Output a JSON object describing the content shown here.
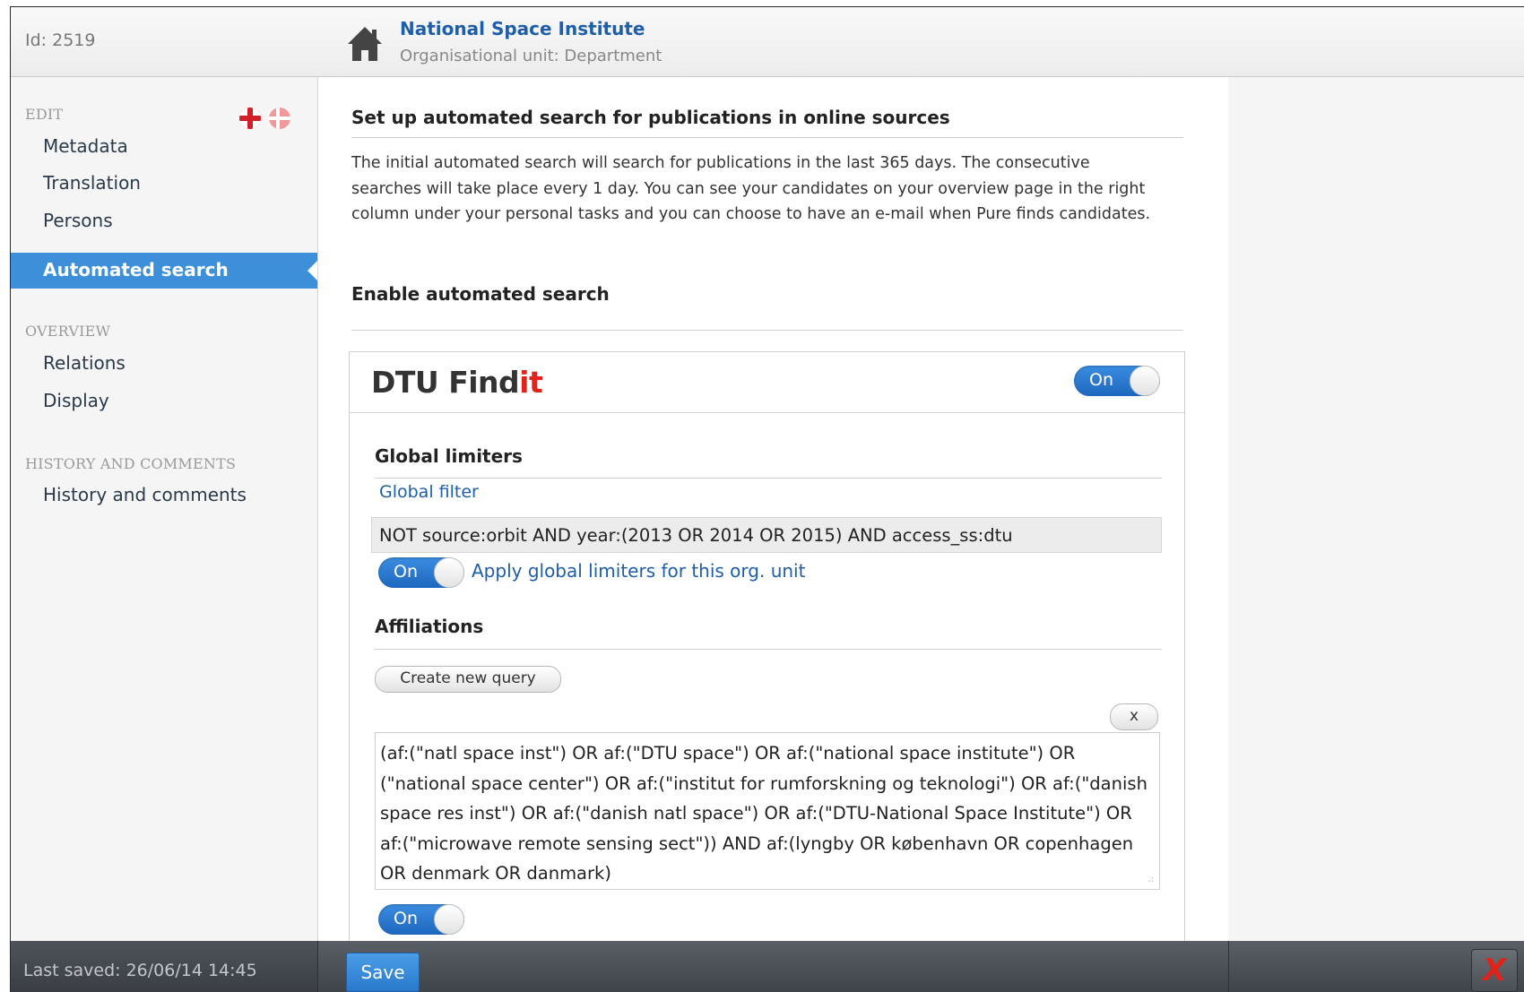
{
  "header": {
    "id_text": "Id: 2519",
    "title": "National Space Institute",
    "subtitle": "Organisational unit: Department",
    "home_icon": "home-icon"
  },
  "sidebar": {
    "edit_heading": "EDIT",
    "flags": [
      "flag-uk-icon",
      "flag-dk-icon"
    ],
    "edit_items": [
      "Metadata",
      "Translation",
      "Persons",
      "Automated search"
    ],
    "active_item": "Automated search",
    "overview_heading": "OVERVIEW",
    "overview_items": [
      "Relations",
      "Display"
    ],
    "history_heading": "HISTORY AND COMMENTS",
    "history_items": [
      "History and comments"
    ]
  },
  "main": {
    "setup_heading": "Set up automated search for publications in online sources",
    "intro_text": "The initial automated search will search for publications in the last 365 days. The consecutive searches will take place every 1 day. You can see your candidates on your overview page in the right column under your personal tasks and you can choose to have an e-mail when Pure finds candidates.",
    "enable_heading": "Enable automated search",
    "findit": {
      "logo_text_main": "DTU Find",
      "logo_text_accent": "it",
      "toggle_label": "On",
      "global_limiters_heading": "Global limiters",
      "global_filter_label": "Global filter",
      "global_filter_value": "NOT source:orbit AND year:(2013 OR 2014 OR 2015) AND access_ss:dtu",
      "apply_toggle_label": "On",
      "apply_label": "Apply global limiters for this org. unit",
      "affiliations_heading": "Affiliations",
      "create_query_label": "Create new query",
      "remove_query_label": "x",
      "query_value": "(af:(\"natl space inst\") OR af:(\"DTU space\") OR af:(\"national space institute\") OR (\"national space center\") OR af:(\"institut for rumforskning og teknologi\") OR af:(\"danish space res inst\") OR af:(\"danish natl space\") OR af:(\"DTU-National Space Institute\") OR af:(\"microwave remote sensing sect\")) AND af:(lyngby OR københavn OR copenhagen OR denmark OR danmark)",
      "query_toggle_label": "On"
    }
  },
  "footer": {
    "last_saved": "Last saved: 26/06/14 14:45",
    "save_label": "Save",
    "close_label": "X"
  },
  "colors": {
    "accent": "#3d8fd9",
    "link": "#1f5ea8",
    "toggle": "#1d67bf",
    "close": "#e0221b"
  }
}
